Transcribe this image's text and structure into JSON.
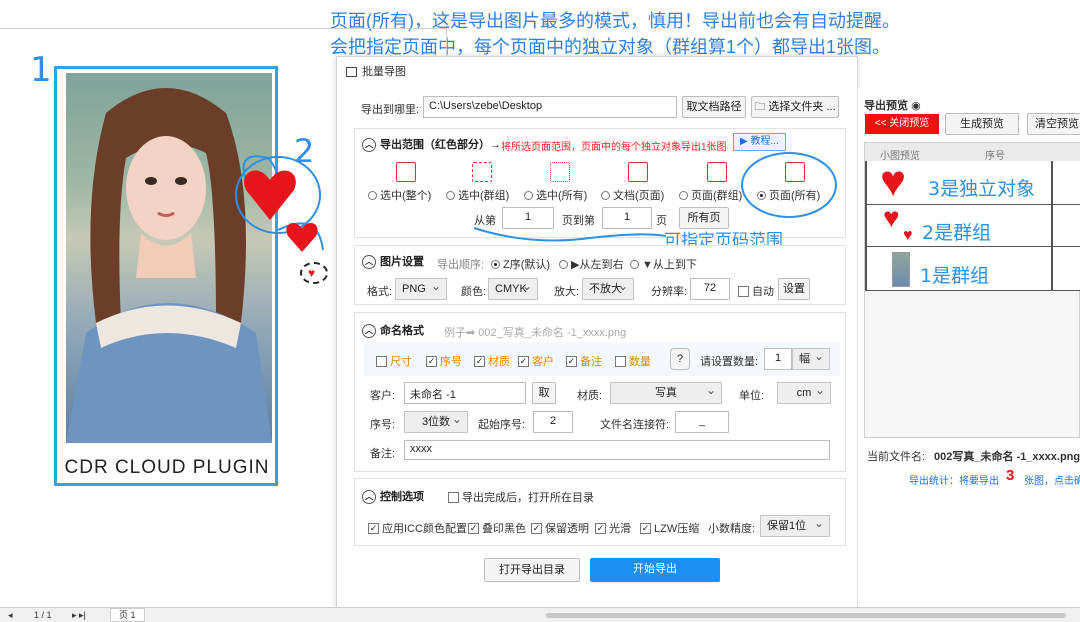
{
  "annotation_top": {
    "line1": "页面(所有)，这是导出图片最多的模式，慎用！导出前也会有自动提醒。",
    "line2": "会把指定页面中，每个页面中的独立对象（群组算1个）都导出1张图。"
  },
  "handwritten": {
    "n1": "1",
    "n2": "2",
    "n3": "3",
    "range_note": "可指定页码范围",
    "p3": "3是独立对象",
    "p2": "2是群组",
    "p1": "1是群组"
  },
  "canvas": {
    "brand": "CDR CLOUD PLUGIN"
  },
  "dialog": {
    "title": "批量导图",
    "export_to_label": "导出到哪里:",
    "export_path": "C:\\Users\\zebe\\Desktop",
    "take_doc_path": "取文档路径",
    "choose_folder": "选择文件夹 ...",
    "range": {
      "title": "导出范围（红色部分）→",
      "note": "将所选页面范围，页面中的每个独立对象导出1张图",
      "tutorial": "▶ 教程...",
      "modes": [
        "选中(整个)",
        "选中(群组)",
        "选中(所有)",
        "文档(页面)",
        "页面(群组)",
        "页面(所有)"
      ],
      "selected_mode": "页面(所有)",
      "from_label": "从第",
      "from_value": "1",
      "to_label": "页到第",
      "to_value": "1",
      "page_suffix": "页",
      "all_pages": "所有页"
    },
    "image": {
      "title": "图片设置",
      "order_label": "导出顺序:",
      "orders": [
        "Z序(默认)",
        "▶从左到右",
        "▼从上到下"
      ],
      "format_label": "格式:",
      "format": "PNG",
      "color_label": "颜色:",
      "color": "CMYK",
      "zoom_label": "放大:",
      "zoom": "不放大",
      "res_label": "分辨率:",
      "res": "72",
      "auto_label": "自动",
      "settings": "设置"
    },
    "naming": {
      "title": "命名格式",
      "example": "例子➡ 002_写真_未命名 -1_xxxx.png",
      "checks": [
        {
          "label": "尺寸",
          "on": false
        },
        {
          "label": "序号",
          "on": true
        },
        {
          "label": "材质",
          "on": true
        },
        {
          "label": "客户",
          "on": true
        },
        {
          "label": "备注",
          "on": true
        },
        {
          "label": "数量",
          "on": false
        }
      ],
      "help": "?",
      "qty_label": "请设置数量:",
      "qty": "1",
      "qty_unit": "幅",
      "client_label": "客户:",
      "client": "未命名 -1",
      "take": "取",
      "material_label": "材质:",
      "material": "写真",
      "unit_label": "单位:",
      "unit": "cm",
      "seq_label": "序号:",
      "seq": "3位数",
      "start_label": "起始序号:",
      "start": "2",
      "joiner_label": "文件名连接符:",
      "joiner": "_",
      "note_label": "备注:",
      "note": "xxxx"
    },
    "control": {
      "title": "控制选项",
      "open_after": "导出完成后，打开所在目录",
      "opts": [
        "应用ICC颜色配置",
        "叠印黑色",
        "保留透明",
        "光滑",
        "LZW压缩"
      ],
      "precision_label": "小数精度:",
      "precision": "保留1位"
    },
    "open_dir": "打开导出目录",
    "start_export": "开始导出"
  },
  "preview": {
    "title": "导出预览",
    "close_preview": "<< 关闭预览",
    "gen_preview": "生成预览",
    "clear_preview": "清空预览",
    "col_thumb": "小图预览",
    "col_seq": "序号",
    "current_file_label": "当前文件名:",
    "current_file": "002写真_未命名 -1_xxxx.png",
    "stat_prefix": "导出统计：将要导出",
    "stat_count": "3",
    "stat_suffix": "张图，点击确"
  },
  "statusbar": {
    "pages": "1 / 1",
    "page_tab": "页 1"
  },
  "colors": {
    "accent": "#1e8ef2",
    "annotation": "#2f8fe5",
    "heart": "#e8141c",
    "danger": "#f01010"
  }
}
